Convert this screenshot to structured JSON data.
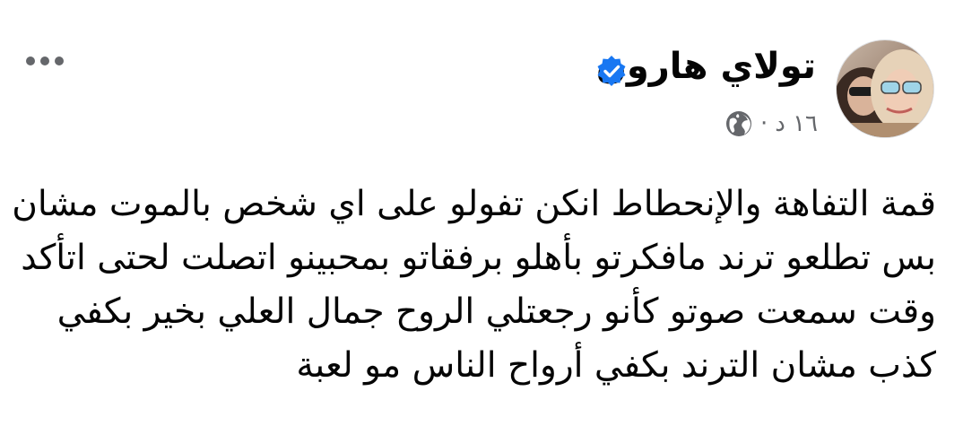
{
  "post": {
    "author": {
      "name": "تولاي هارون",
      "verified": true
    },
    "meta": {
      "time": "١٦ د",
      "separator": "·",
      "audience_icon": "globe-icon"
    },
    "text_lines": [
      "قمة التفاهة والإنحطاط انكن تفولو على اي شخص بالموت مشان",
      "بس تطلعو ترند مافكرتو بأهلو برفقاتو بمحبينو اتصلت لحتى اتأكد",
      "وقت سمعت صوتو كأنو رجعتلي الروح جمال العلي بخير بكفي",
      "كذب مشان الترند بكفي أرواح الناس مو لعبة"
    ],
    "more_icon": "more-options-icon"
  },
  "colors": {
    "name": "#050505",
    "meta": "#65676b",
    "verified": "#1877f2",
    "text": "#050505"
  }
}
